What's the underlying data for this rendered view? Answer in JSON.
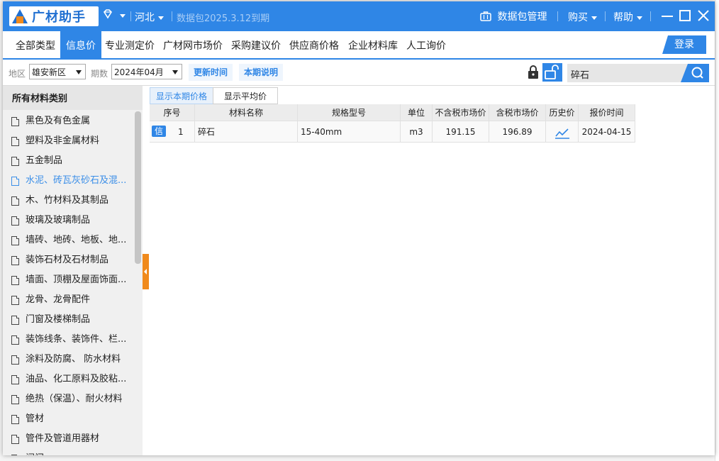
{
  "app": {
    "logo_text": "广材助手",
    "region": "河北",
    "package_expiry": "数据包2025.3.12到期",
    "data_package_label": "数据包管理",
    "buy_label": "购买",
    "help_label": "帮助"
  },
  "menu": {
    "tabs": [
      {
        "label": "全部类型"
      },
      {
        "label": "信息价"
      },
      {
        "label": "专业测定价"
      },
      {
        "label": "广材网市场价"
      },
      {
        "label": "采购建议价"
      },
      {
        "label": "供应商价格"
      },
      {
        "label": "企业材料库"
      },
      {
        "label": "人工询价"
      }
    ],
    "active_tab": "信息价",
    "login_label": "登录"
  },
  "filters": {
    "region_label": "地区",
    "region_value": "雄安新区",
    "period_label": "期数",
    "period_value": "2024年04月",
    "update_time_btn": "更新时间",
    "period_desc_btn": "本期说明",
    "search_value": "碎石"
  },
  "sidebar": {
    "title": "所有材料类别",
    "selected": "水泥、砖瓦灰砂石及混...",
    "items": [
      {
        "label": "黑色及有色金属"
      },
      {
        "label": "塑料及非金属材料"
      },
      {
        "label": "五金制品"
      },
      {
        "label": "水泥、砖瓦灰砂石及混..."
      },
      {
        "label": "木、竹材料及其制品"
      },
      {
        "label": "玻璃及玻璃制品"
      },
      {
        "label": "墙砖、地砖、地板、地..."
      },
      {
        "label": "装饰石材及石材制品"
      },
      {
        "label": "墙面、顶棚及屋面饰面..."
      },
      {
        "label": "龙骨、龙骨配件"
      },
      {
        "label": "门窗及楼梯制品"
      },
      {
        "label": "装饰线条、装饰件、栏..."
      },
      {
        "label": "涂料及防腐、 防水材料"
      },
      {
        "label": "油品、化工原料及胶粘..."
      },
      {
        "label": "绝热（保温）、耐火材料"
      },
      {
        "label": "管材"
      },
      {
        "label": "管件及管道用器材"
      },
      {
        "label": "阀门"
      }
    ]
  },
  "view_tabs": {
    "current": "显示本期价格",
    "average": "显示平均价"
  },
  "table": {
    "headers": {
      "seq": "序号",
      "name": "材料名称",
      "spec": "规格型号",
      "unit": "单位",
      "price_ex_tax": "不含税市场价",
      "price_in_tax": "含税市场价",
      "history": "历史价",
      "date": "报价时间"
    },
    "rows": [
      {
        "badge": "信",
        "seq": "1",
        "name": "碎石",
        "spec": "15-40mm",
        "unit": "m3",
        "price_ex_tax": "191.15",
        "price_in_tax": "196.89",
        "history_icon": "trend-chart-icon",
        "date": "2024-04-15"
      }
    ]
  },
  "colors": {
    "primary": "#2f86e6",
    "accent_orange": "#f08a1c",
    "selected_text": "#3a8ee8"
  }
}
